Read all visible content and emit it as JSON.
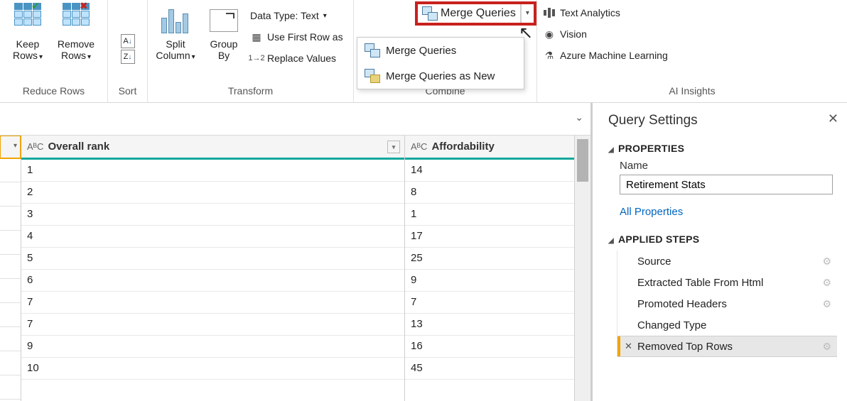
{
  "ribbon": {
    "groups": {
      "reduce": {
        "label": "Reduce Rows",
        "keep": "Keep\nRows",
        "remove": "Remove\nRows"
      },
      "sort": {
        "label": "Sort"
      },
      "transform": {
        "label": "Transform",
        "split": "Split\nColumn",
        "groupby": "Group\nBy",
        "datatype": "Data Type: Text",
        "firstrow": "Use First Row as",
        "replace": "Replace Values"
      },
      "combine": {
        "label": "Combine",
        "merge": "Merge Queries",
        "menu": {
          "merge": "Merge Queries",
          "merge_new": "Merge Queries as New"
        }
      },
      "ai": {
        "label": "AI Insights",
        "text": "Text Analytics",
        "vision": "Vision",
        "aml": "Azure Machine Learning"
      }
    }
  },
  "grid": {
    "columns": [
      "Overall rank",
      "Affordability"
    ],
    "type_glyph": "AᴮC",
    "rows": [
      {
        "rank": "1",
        "afford": "14"
      },
      {
        "rank": "2",
        "afford": "8"
      },
      {
        "rank": "3",
        "afford": "1"
      },
      {
        "rank": "4",
        "afford": "17"
      },
      {
        "rank": "5",
        "afford": "25"
      },
      {
        "rank": "6",
        "afford": "9"
      },
      {
        "rank": "7",
        "afford": "7"
      },
      {
        "rank": "7",
        "afford": "13"
      },
      {
        "rank": "9",
        "afford": "16"
      },
      {
        "rank": "10",
        "afford": "45"
      }
    ]
  },
  "settings": {
    "title": "Query Settings",
    "props_hdr": "PROPERTIES",
    "name_label": "Name",
    "name_value": "Retirement Stats",
    "all_props": "All Properties",
    "steps_hdr": "APPLIED STEPS",
    "steps": [
      {
        "label": "Source",
        "gear": true
      },
      {
        "label": "Extracted Table From Html",
        "gear": true
      },
      {
        "label": "Promoted Headers",
        "gear": true
      },
      {
        "label": "Changed Type",
        "gear": false
      },
      {
        "label": "Removed Top Rows",
        "gear": true,
        "selected": true
      }
    ]
  }
}
